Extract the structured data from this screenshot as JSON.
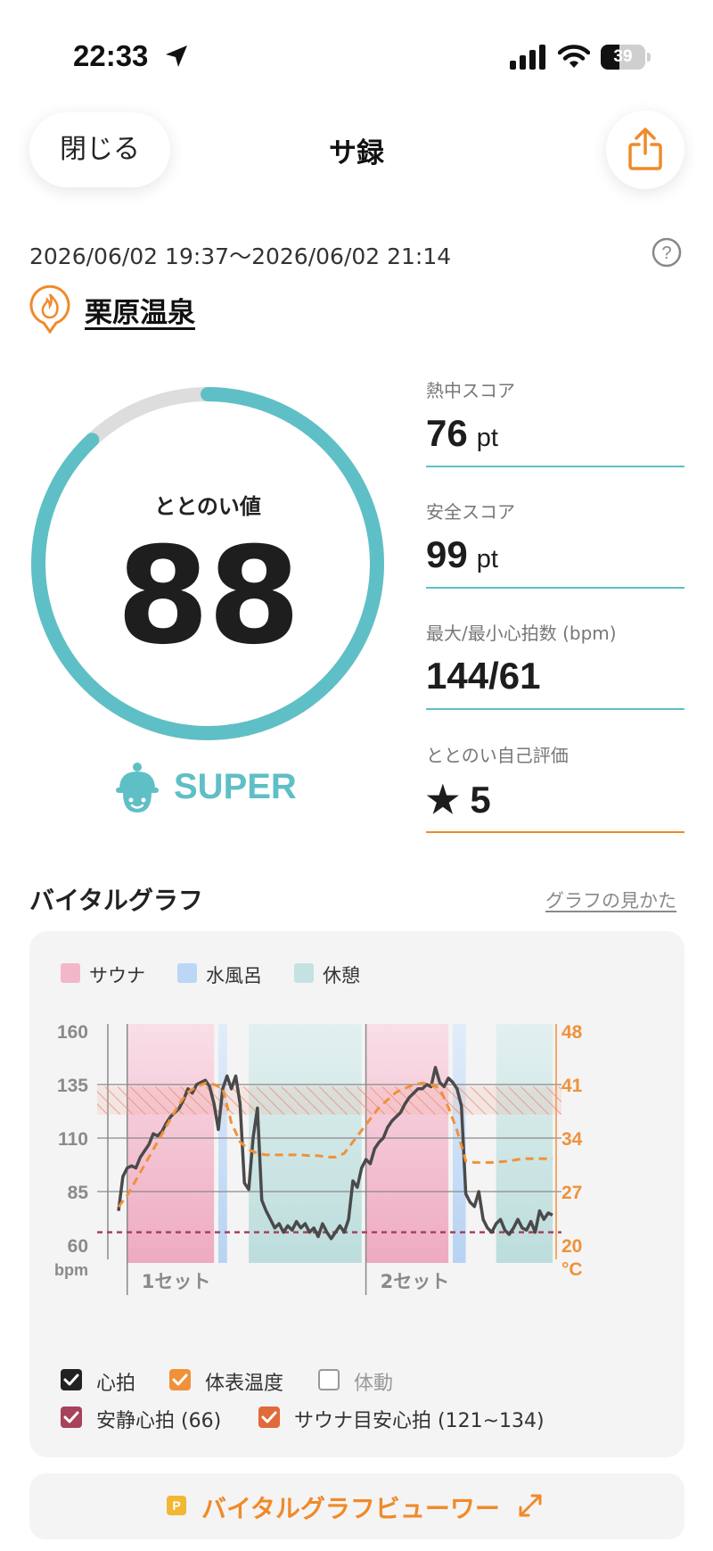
{
  "status_bar": {
    "time": "22:33",
    "battery": "39"
  },
  "header": {
    "close_label": "閉じる",
    "title": "サ録"
  },
  "session": {
    "date_range": "2026/06/02 19:37〜2026/06/02 21:14",
    "facility": "栗原温泉"
  },
  "gauge": {
    "label": "ととのい値",
    "value": "88",
    "fraction": 0.88,
    "rank": "SUPER",
    "ring_color": "#5fbfc6",
    "track_color": "#dddddd"
  },
  "stats": [
    {
      "label": "熱中スコア",
      "value": "76",
      "unit": "pt"
    },
    {
      "label": "安全スコア",
      "value": "99",
      "unit": "pt"
    },
    {
      "label": "最大/最小心拍数 (bpm)",
      "value": "144/61",
      "unit": ""
    },
    {
      "label": "ととのい自己評価",
      "value": "★ 5",
      "unit": ""
    }
  ],
  "vital": {
    "title": "バイタルグラフ",
    "guide_link": "グラフの見かた",
    "legend": [
      {
        "label": "サウナ",
        "color": "#f2b8c9"
      },
      {
        "label": "水風呂",
        "color": "#bcd6f5"
      },
      {
        "label": "休憩",
        "color": "#c4e2e2"
      }
    ],
    "toggles": [
      {
        "label": "心拍",
        "checked": true,
        "color": "#222222"
      },
      {
        "label": "体表温度",
        "checked": true,
        "color": "#f0913a"
      },
      {
        "label": "体動",
        "checked": false,
        "color": "#999999"
      },
      {
        "label": "安静心拍 (66)",
        "checked": true,
        "color": "#a8415c"
      },
      {
        "label": "サウナ目安心拍 (121~134)",
        "checked": true,
        "color": "#e06a3a"
      }
    ],
    "viewer_badge": "P",
    "viewer_label": "バイタルグラフビューワー"
  },
  "chart_data": {
    "type": "line",
    "x_unit": "minutes",
    "y_left": {
      "label": "bpm",
      "ticks": [
        "160",
        "135",
        "110",
        "85",
        "60"
      ],
      "range": [
        60,
        160
      ]
    },
    "y_right": {
      "label": "°C",
      "ticks": [
        "48",
        "41",
        "34",
        "27",
        "20"
      ],
      "range": [
        20,
        48
      ]
    },
    "x_range": [
      0,
      100
    ],
    "sets": [
      {
        "label": "1セット",
        "x": 2
      },
      {
        "label": "2セット",
        "x": 57
      }
    ],
    "phases": [
      {
        "type": "sauna",
        "start": 2,
        "end": 22
      },
      {
        "type": "cold",
        "start": 23,
        "end": 25
      },
      {
        "type": "rest",
        "start": 30,
        "end": 56
      },
      {
        "type": "sauna",
        "start": 57,
        "end": 76
      },
      {
        "type": "cold",
        "start": 77,
        "end": 80
      },
      {
        "type": "rest",
        "start": 87,
        "end": 100
      }
    ],
    "target_band": [
      121,
      134
    ],
    "resting_hr": 66,
    "series": [
      {
        "name": "心拍",
        "x": [
          0,
          1,
          2,
          3,
          4,
          5,
          6,
          7,
          8,
          9,
          10,
          11,
          12,
          13,
          14,
          15,
          16,
          17,
          18,
          19,
          20,
          21,
          22,
          23,
          24,
          25,
          26,
          27,
          28,
          29,
          30,
          31,
          32,
          33,
          34,
          35,
          36,
          37,
          38,
          39,
          40,
          41,
          42,
          43,
          44,
          45,
          46,
          47,
          48,
          49,
          50,
          51,
          52,
          53,
          54,
          55,
          56,
          57,
          58,
          59,
          60,
          61,
          62,
          63,
          64,
          65,
          66,
          67,
          68,
          69,
          70,
          71,
          72,
          73,
          74,
          75,
          76,
          77,
          78,
          79,
          80,
          81,
          82,
          83,
          84,
          85,
          86,
          87,
          88,
          89,
          90,
          91,
          92,
          93,
          94,
          95,
          96,
          97,
          98,
          99,
          100
        ],
        "values": [
          76,
          92,
          96,
          97,
          96,
          101,
          104,
          107,
          112,
          111,
          113,
          117,
          120,
          122,
          124,
          128,
          133,
          131,
          135,
          136,
          137,
          134,
          126,
          114,
          133,
          139,
          133,
          139,
          126,
          89,
          86,
          110,
          124,
          81,
          76,
          72,
          68,
          70,
          66,
          69,
          67,
          71,
          68,
          70,
          66,
          68,
          64,
          70,
          66,
          63,
          66,
          69,
          66,
          72,
          90,
          87,
          96,
          100,
          98,
          105,
          108,
          110,
          115,
          118,
          120,
          122,
          126,
          129,
          131,
          133,
          133,
          135,
          134,
          143,
          136,
          134,
          138,
          136,
          133,
          125,
          84,
          80,
          78,
          85,
          72,
          68,
          66,
          70,
          72,
          67,
          65,
          68,
          72,
          68,
          67,
          71,
          66,
          76,
          72,
          75,
          74
        ]
      },
      {
        "name": "体表温度",
        "x": [
          0,
          2,
          4,
          6,
          8,
          10,
          12,
          14,
          16,
          18,
          20,
          22,
          24,
          26,
          28,
          30,
          32,
          34,
          36,
          38,
          40,
          42,
          44,
          46,
          48,
          50,
          52,
          54,
          56,
          58,
          60,
          62,
          64,
          66,
          68,
          70,
          72,
          74,
          76,
          78,
          80,
          82,
          84,
          86,
          88,
          90,
          92,
          94,
          96,
          98,
          100
        ],
        "values": [
          25,
          26.5,
          28.5,
          30.5,
          32.5,
          34.5,
          36.5,
          38.5,
          40,
          40.7,
          41.2,
          41,
          40.5,
          36,
          33.5,
          32.5,
          32,
          31.8,
          31.8,
          31.8,
          31.8,
          31.8,
          31.7,
          31.7,
          31.5,
          31.5,
          32,
          33.5,
          35,
          36.5,
          38,
          39,
          40,
          40.5,
          41,
          41.2,
          41,
          40.5,
          38,
          35,
          31,
          30.8,
          30.8,
          30.8,
          30.9,
          31,
          31.2,
          31.3,
          31.3,
          31.3,
          31.3
        ]
      }
    ]
  }
}
